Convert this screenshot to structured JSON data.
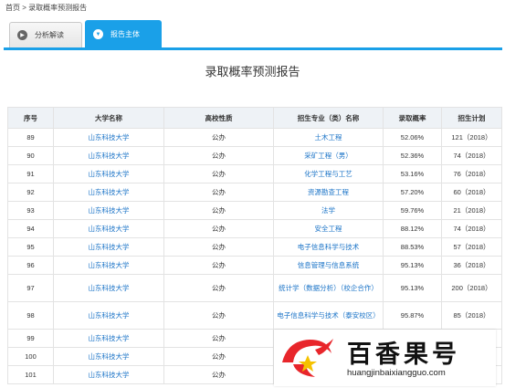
{
  "breadcrumb": "首页 > 录取概率预测报告",
  "tabs": [
    {
      "label": "分析解读",
      "icon": "play-icon",
      "active": false
    },
    {
      "label": "报告主体",
      "icon": "chevron-down-icon",
      "active": true
    }
  ],
  "report_title": "录取概率预测报告",
  "table": {
    "headers": [
      "序号",
      "大学名称",
      "高校性质",
      "招生专业（类）名称",
      "录取概率",
      "招生计划"
    ],
    "rows": [
      [
        "89",
        "山东科技大学",
        "公办",
        "土木工程",
        "52.06%",
        "121（2018）"
      ],
      [
        "90",
        "山东科技大学",
        "公办",
        "采矿工程（男）",
        "52.36%",
        "74（2018）"
      ],
      [
        "91",
        "山东科技大学",
        "公办",
        "化学工程与工艺",
        "53.16%",
        "76（2018）"
      ],
      [
        "92",
        "山东科技大学",
        "公办",
        "资源勘查工程",
        "57.20%",
        "60（2018）"
      ],
      [
        "93",
        "山东科技大学",
        "公办",
        "法学",
        "59.76%",
        "21（2018）"
      ],
      [
        "94",
        "山东科技大学",
        "公办",
        "安全工程",
        "88.12%",
        "74（2018）"
      ],
      [
        "95",
        "山东科技大学",
        "公办",
        "电子信息科学与技术",
        "88.53%",
        "57（2018）"
      ],
      [
        "96",
        "山东科技大学",
        "公办",
        "信息管理与信息系统",
        "95.13%",
        "36（2018）"
      ],
      [
        "97",
        "山东科技大学",
        "公办",
        "统计学（数据分析）（校企合作）",
        "95.13%",
        "200（2018）"
      ],
      [
        "98",
        "山东科技大学",
        "公办",
        "电子信息科学与技术（泰安校区）",
        "95.87%",
        "85（2018）"
      ],
      [
        "99",
        "山东科技大学",
        "公办",
        "",
        "",
        ""
      ],
      [
        "100",
        "山东科技大学",
        "公办",
        "",
        "",
        ""
      ],
      [
        "101",
        "山东科技大学",
        "公办",
        "",
        "",
        ""
      ]
    ]
  },
  "watermark": {
    "brand": "百香果号",
    "url": "huangjinbaixiangguo.com",
    "colors": {
      "logo_red": "#e8262b",
      "logo_gold": "#f5c200"
    }
  }
}
